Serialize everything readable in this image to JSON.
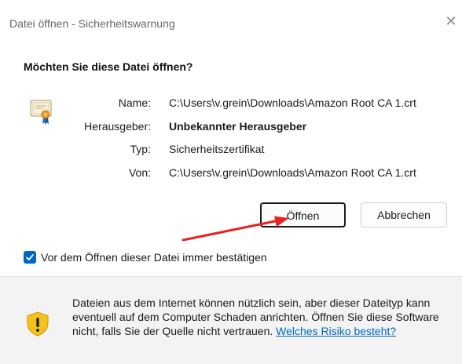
{
  "window": {
    "title": "Datei öffnen - Sicherheitswarnung",
    "close_glyph": "✕"
  },
  "dialog": {
    "heading": "Möchten Sie diese Datei öffnen?",
    "fields": {
      "name_label": "Name:",
      "name_value": "C:\\Users\\v.grein\\Downloads\\Amazon Root CA 1.crt",
      "publisher_label": "Herausgeber:",
      "publisher_value": "Unbekannter Herausgeber",
      "type_label": "Typ:",
      "type_value": "Sicherheitszertifikat",
      "from_label": "Von:",
      "from_value": "C:\\Users\\v.grein\\Downloads\\Amazon Root CA 1.crt"
    },
    "buttons": {
      "open_label": "Öffnen",
      "cancel_label": "Abbrechen"
    },
    "checkbox": {
      "label": "Vor dem Öffnen dieser Datei immer bestätigen",
      "checked": true
    }
  },
  "footer": {
    "warning_text": "Dateien aus dem Internet können nützlich sein, aber dieser Dateityp kann eventuell auf dem Computer Schaden anrichten. Öffnen Sie diese Software nicht, falls Sie der Quelle nicht vertrauen. ",
    "link_label": "Welches Risiko besteht?"
  },
  "colors": {
    "accent": "#0067c0",
    "annotation_arrow": "#e8231f",
    "shield": "#f4c21b"
  },
  "icons": {
    "file_icon": "certificate-icon",
    "warning_icon": "shield-warning-icon",
    "close_icon": "close-icon",
    "check_icon": "checkmark-icon"
  }
}
